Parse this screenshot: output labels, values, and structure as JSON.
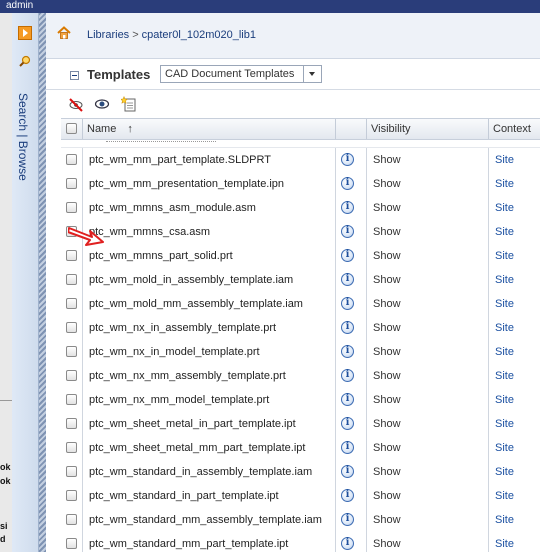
{
  "window": {
    "title": "admin"
  },
  "nav": {
    "tabs_label": "Search | Browse"
  },
  "breadcrumb": {
    "items": [
      "Libraries",
      "cpater0l_102m020_lib1"
    ],
    "separator": ">"
  },
  "templates": {
    "title": "Templates",
    "type_select": "CAD Document Templates"
  },
  "table": {
    "columns": {
      "name": "Name",
      "sort": "↑",
      "visibility": "Visibility",
      "context": "Context"
    },
    "rows": [
      {
        "name": "ptc_wm_mm_part_template.SLDPRT",
        "visibility": "Show",
        "context": "Site"
      },
      {
        "name": "ptc_wm_mm_presentation_template.ipn",
        "visibility": "Show",
        "context": "Site"
      },
      {
        "name": "ptc_wm_mmns_asm_module.asm",
        "visibility": "Show",
        "context": "Site"
      },
      {
        "name": "ptc_wm_mmns_csa.asm",
        "visibility": "Show",
        "context": "Site"
      },
      {
        "name": "ptc_wm_mmns_part_solid.prt",
        "visibility": "Show",
        "context": "Site"
      },
      {
        "name": "ptc_wm_mold_in_assembly_template.iam",
        "visibility": "Show",
        "context": "Site"
      },
      {
        "name": "ptc_wm_mold_mm_assembly_template.iam",
        "visibility": "Show",
        "context": "Site"
      },
      {
        "name": "ptc_wm_nx_in_assembly_template.prt",
        "visibility": "Show",
        "context": "Site"
      },
      {
        "name": "ptc_wm_nx_in_model_template.prt",
        "visibility": "Show",
        "context": "Site"
      },
      {
        "name": "ptc_wm_nx_mm_assembly_template.prt",
        "visibility": "Show",
        "context": "Site"
      },
      {
        "name": "ptc_wm_nx_mm_model_template.prt",
        "visibility": "Show",
        "context": "Site"
      },
      {
        "name": "ptc_wm_sheet_metal_in_part_template.ipt",
        "visibility": "Show",
        "context": "Site"
      },
      {
        "name": "ptc_wm_sheet_metal_mm_part_template.ipt",
        "visibility": "Show",
        "context": "Site"
      },
      {
        "name": "ptc_wm_standard_in_assembly_template.iam",
        "visibility": "Show",
        "context": "Site"
      },
      {
        "name": "ptc_wm_standard_in_part_template.ipt",
        "visibility": "Show",
        "context": "Site"
      },
      {
        "name": "ptc_wm_standard_mm_assembly_template.iam",
        "visibility": "Show",
        "context": "Site"
      },
      {
        "name": "ptc_wm_standard_mm_part_template.ipt",
        "visibility": "Show",
        "context": "Site"
      }
    ]
  },
  "background_window": {
    "fragments": [
      "ok",
      "ok",
      "si",
      "d"
    ]
  },
  "icons": {
    "home": "home-icon",
    "search": "search-icon",
    "collapse": "collapse-icon",
    "info": "info-icon",
    "hide": "hide-icon",
    "view": "view-icon",
    "new": "new-template-icon",
    "annotation": "red-arrow-icon"
  },
  "colors": {
    "header_bar": "#2a3d7a",
    "link": "#1a3d7c",
    "accent_orange": "#f59a23",
    "annotation_red": "#e02020"
  }
}
